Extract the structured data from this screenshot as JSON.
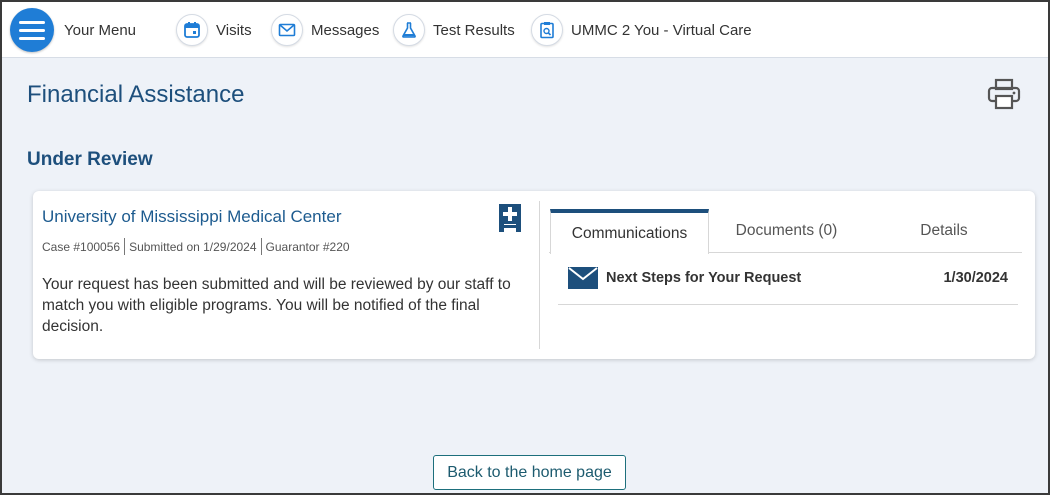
{
  "nav": {
    "menu_label": "Your Menu",
    "items": [
      {
        "label": "Visits",
        "icon": "calendar-icon"
      },
      {
        "label": "Messages",
        "icon": "envelope-icon"
      },
      {
        "label": "Test Results",
        "icon": "flask-icon"
      },
      {
        "label": "UMMC 2 You - Virtual Care",
        "icon": "clipboard-search-icon"
      }
    ]
  },
  "page": {
    "title": "Financial Assistance",
    "section_title": "Under Review",
    "print_icon": "printer-icon"
  },
  "case": {
    "organization": "University of Mississippi Medical Center",
    "organization_icon": "hospital-icon",
    "case_number": "Case #100056",
    "submitted": "Submitted on 1/29/2024",
    "guarantor": "Guarantor #220",
    "description": "Your request has been submitted and will be reviewed by our staff to match you with eligible programs. You will be notified of the final decision."
  },
  "tabs": [
    {
      "label": "Communications",
      "active": true
    },
    {
      "label": "Documents (0)",
      "active": false
    },
    {
      "label": "Details",
      "active": false
    }
  ],
  "communications": [
    {
      "title": "Next Steps for Your Request",
      "date": "1/30/2024",
      "icon": "envelope-icon"
    }
  ],
  "footer": {
    "home_button": "Back to the home page"
  },
  "colors": {
    "accent": "#1d4f7c",
    "menu_button": "#1f7dd6",
    "background": "#eef2f8"
  }
}
